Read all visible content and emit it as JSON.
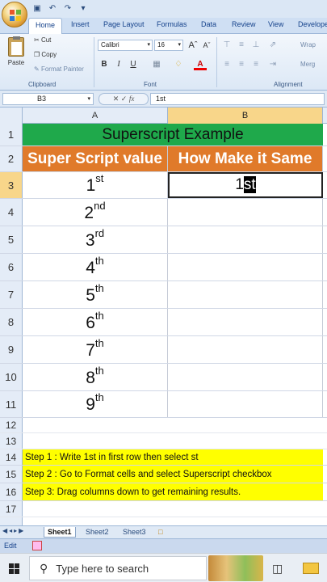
{
  "ribbon": {
    "tabs": [
      "Home",
      "Insert",
      "Page Layout",
      "Formulas",
      "Data",
      "Review",
      "View",
      "Develope"
    ],
    "clipboard": {
      "paste": "Paste",
      "cut": "Cut",
      "copy": "Copy",
      "format_painter": "Format Painter",
      "label": "Clipboard"
    },
    "font": {
      "name": "Calibri",
      "size": "16",
      "label": "Font",
      "bold": "B",
      "italic": "I",
      "underline": "U"
    },
    "alignment": {
      "wrap": "Wrap",
      "merge": "Merg",
      "label": "Alignment"
    }
  },
  "formula_bar": {
    "name_box": "B3",
    "fx": "fx",
    "content": "1st"
  },
  "columns": [
    "A",
    "B"
  ],
  "rows": {
    "r1": {
      "num": "1",
      "title": "Superscript Example"
    },
    "r2": {
      "num": "2",
      "a": "Super Script value",
      "b": "How Make it Same"
    },
    "r3": {
      "num": "3",
      "a_base": "1",
      "a_sup": "st",
      "b_base": "1",
      "b_sel": "st"
    },
    "r4": {
      "num": "4",
      "base": "2",
      "sup": "nd"
    },
    "r5": {
      "num": "5",
      "base": "3",
      "sup": "rd"
    },
    "r6": {
      "num": "6",
      "base": "4",
      "sup": "th"
    },
    "r7": {
      "num": "7",
      "base": "5",
      "sup": "th"
    },
    "r8": {
      "num": "8",
      "base": "6",
      "sup": "th"
    },
    "r9": {
      "num": "9",
      "base": "7",
      "sup": "th"
    },
    "r10": {
      "num": "10",
      "base": "8",
      "sup": "th"
    },
    "r11": {
      "num": "11",
      "base": "9",
      "sup": "th"
    },
    "r12": {
      "num": "12"
    },
    "r13": {
      "num": "13"
    },
    "r14": {
      "num": "14",
      "text": "Step 1 : Write 1st in first row then select st"
    },
    "r15": {
      "num": "15",
      "text": "Step 2 : Go to Format cells and select Superscript checkbox"
    },
    "r16": {
      "num": "16",
      "text": "Step 3: Drag columns down to get remaining results."
    },
    "r17": {
      "num": "17"
    }
  },
  "sheets": [
    "Sheet1",
    "Sheet2",
    "Sheet3"
  ],
  "status": {
    "mode": "Edit"
  },
  "taskbar": {
    "search_placeholder": "Type here to search"
  },
  "colors": {
    "header_green": "#1fa94b",
    "header_orange": "#e07a2a",
    "step_yellow": "#ffff00",
    "selected_header": "#f8d68a"
  }
}
